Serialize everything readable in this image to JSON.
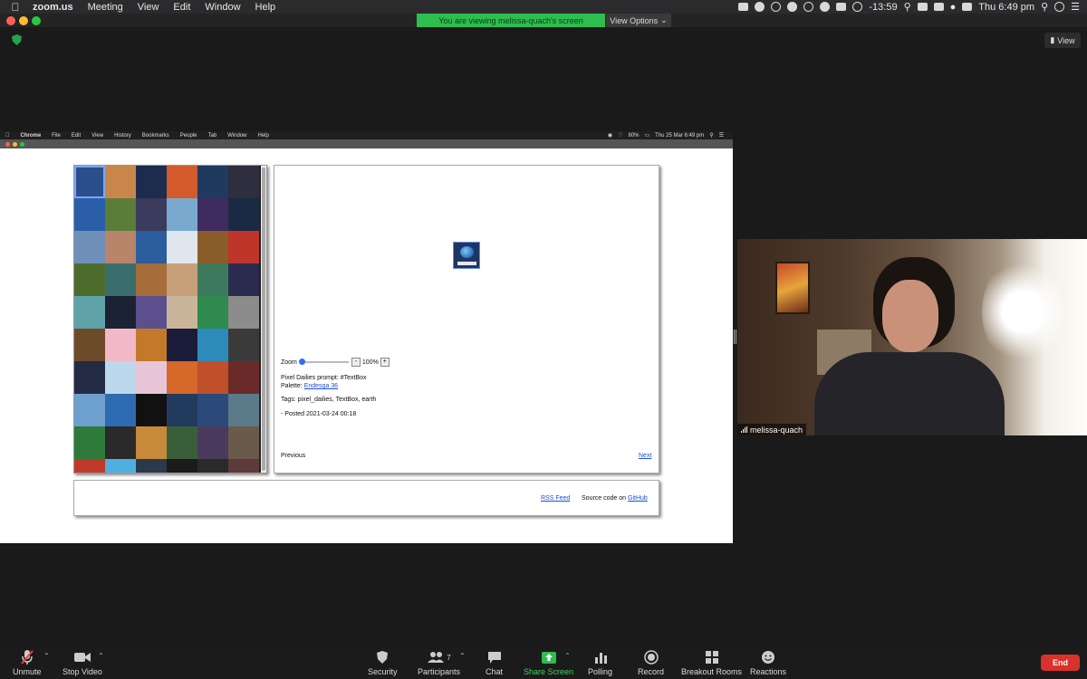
{
  "mac_menubar": {
    "app": "zoom.us",
    "menus": [
      "Meeting",
      "View",
      "Edit",
      "Window",
      "Help"
    ],
    "timer": "-13:59",
    "clock": "Thu 6:49 pm"
  },
  "zoom": {
    "banner": "You are viewing melissa-quach's screen",
    "view_options": "View Options",
    "view_button": "View"
  },
  "shared_screen": {
    "menubar": {
      "app": "Chrome",
      "menus": [
        "File",
        "Edit",
        "View",
        "History",
        "Bookmarks",
        "People",
        "Tab",
        "Window",
        "Help"
      ],
      "battery": "80%",
      "clock": "Thu 25 Mar  6:49 pm"
    },
    "gallery_colors": [
      "#2b4f8a",
      "#c8864a",
      "#1d2b4e",
      "#d35a2a",
      "#1f3a5e",
      "#2e2e3e",
      "#2a5fa8",
      "#5a7d3a",
      "#3b3b5e",
      "#7aa9cf",
      "#3f2b5e",
      "#1a2a44",
      "#6e8fb8",
      "#b9856a",
      "#2c5d9c",
      "#dfe6ee",
      "#8a5c2a",
      "#c0352a",
      "#4d6b2a",
      "#3a6e6e",
      "#a66c3a",
      "#c7a07a",
      "#3d7a5d",
      "#2b2b4f",
      "#5fa3a8",
      "#1a2233",
      "#5b4f8e",
      "#c9b59a",
      "#2f8a4f",
      "#8c8c8c",
      "#6c4a2a",
      "#f2b8c8",
      "#c27a2a",
      "#1b1b3a",
      "#2e8ab8",
      "#3a3a3a",
      "#232b44",
      "#bcd8ec",
      "#e6c6d8",
      "#d6682a",
      "#c0502a",
      "#6a2a2a",
      "#6ea0cf",
      "#2f6bb0",
      "#111111",
      "#223a5e",
      "#2b4a7a",
      "#5b7a8a",
      "#2e7a3a",
      "#2a2a2a",
      "#c78a3a",
      "#3a5e3a",
      "#4a3a5e",
      "#6a5a4a",
      "#c03a2a",
      "#4fb0e0",
      "#2a3a4a",
      "#1b1b1b",
      "#2a2a2a",
      "#5e3a3a"
    ],
    "zoom_label": "Zoom",
    "zoom_minus": "-",
    "zoom_value": "100%",
    "zoom_plus": "+",
    "prompt": "Pixel Dailies prompt: #TextBox",
    "palette_label": "Palette:",
    "palette_link": "Endesga 36",
    "tags": "Tags: pixel_dailies, TextBox, earth",
    "posted": "- Posted 2021-03-24 00:18",
    "previous": "Previous",
    "next": "Next",
    "rss": "RSS Feed",
    "source_label": "Source code on",
    "github": "GitHub"
  },
  "video": {
    "name": "melissa-quach"
  },
  "toolbar": {
    "unmute": "Unmute",
    "stop_video": "Stop Video",
    "security": "Security",
    "participants": "Participants",
    "participants_count": "7",
    "chat": "Chat",
    "share_screen": "Share Screen",
    "polling": "Polling",
    "record": "Record",
    "breakout_rooms": "Breakout Rooms",
    "reactions": "Reactions",
    "end": "End"
  }
}
